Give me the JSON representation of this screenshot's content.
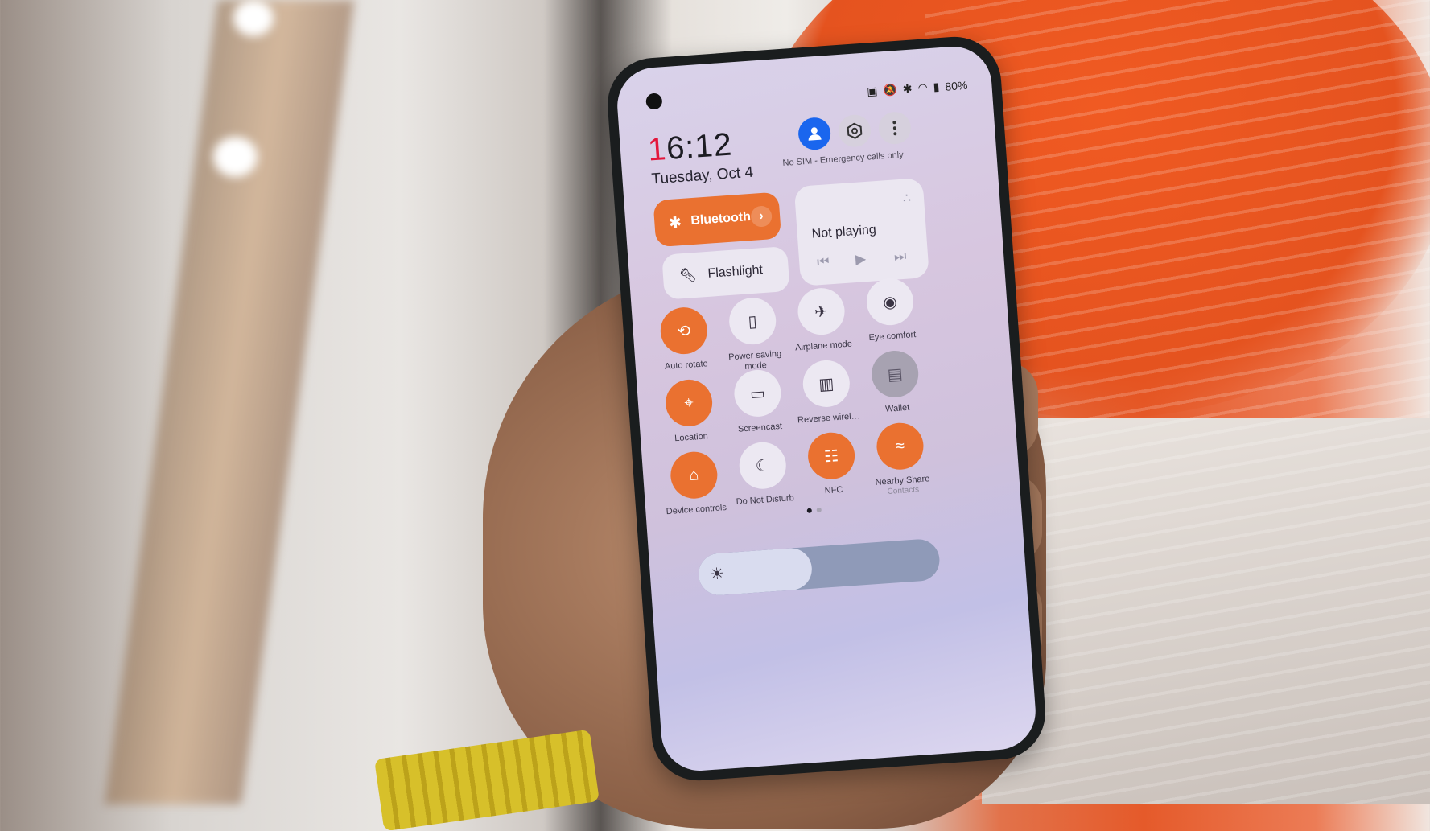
{
  "status_bar": {
    "icons": [
      "nfc-icon",
      "mute-icon",
      "bluetooth-icon",
      "wifi-icon",
      "battery-icon"
    ],
    "battery": "80%"
  },
  "header": {
    "time_first_digit": "1",
    "time_rest": "6:12",
    "date": "Tuesday, Oct 4",
    "sim_status": "No SIM - Emergency calls only"
  },
  "tiles": {
    "bluetooth": {
      "label": "Bluetooth",
      "state": "on"
    },
    "flashlight": {
      "label": "Flashlight",
      "state": "off"
    }
  },
  "media": {
    "status": "Not playing"
  },
  "quick_settings": [
    {
      "label": "Auto rotate",
      "icon": "auto-rotate-icon",
      "state": "on"
    },
    {
      "label": "Power saving mode",
      "icon": "battery-saver-icon",
      "state": "off"
    },
    {
      "label": "Airplane mode",
      "icon": "airplane-icon",
      "state": "off"
    },
    {
      "label": "Eye comfort",
      "icon": "eye-icon",
      "state": "off"
    },
    {
      "label": "Location",
      "icon": "location-icon",
      "state": "on"
    },
    {
      "label": "Screencast",
      "icon": "cast-icon",
      "state": "off"
    },
    {
      "label": "Reverse wirel…",
      "icon": "reverse-wireless-icon",
      "state": "off"
    },
    {
      "label": "Wallet",
      "icon": "wallet-icon",
      "state": "disabled"
    },
    {
      "label": "Device controls",
      "icon": "home-icon",
      "state": "on"
    },
    {
      "label": "Do Not Disturb",
      "icon": "moon-icon",
      "state": "off"
    },
    {
      "label": "NFC",
      "icon": "nfc-icon",
      "state": "on"
    },
    {
      "label": "Nearby Share",
      "sublabel": "Contacts",
      "icon": "nearby-share-icon",
      "state": "on"
    }
  ],
  "pager": {
    "pages": 2,
    "current": 1
  },
  "brightness": {
    "level_percent": 47,
    "mode": "auto"
  },
  "colors": {
    "accent": "#ea7130",
    "user_blue": "#1a66ee",
    "clock_red": "#e3163b"
  }
}
